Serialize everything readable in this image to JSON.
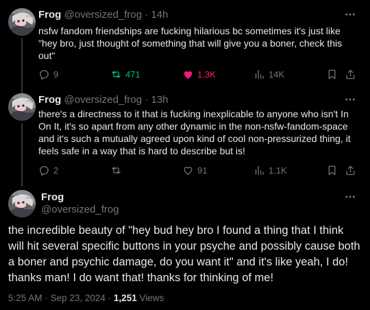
{
  "tweets": [
    {
      "name": "Frog",
      "handle": "@oversized_frog",
      "separator": "·",
      "time": "14h",
      "text": "nsfw fandom friendships are fucking hilarious bc sometimes it's just like \"hey bro, just thought of something that will give you a boner, check this out\"",
      "replies": "9",
      "reposts": "471",
      "likes": "1.3K",
      "views": "14K"
    },
    {
      "name": "Frog",
      "handle": "@oversized_frog",
      "separator": "·",
      "time": "13h",
      "text": "there's a directness to it that is fucking inexplicable to anyone who isn't In On It, it's so apart from any other dynamic in the non-nsfw-fandom-space and it's such a mutually agreed upon kind of cool non-pressurized thing, it feels safe in a way that is hard to describe but is!",
      "replies": "2",
      "reposts": "",
      "likes": "91",
      "views": "1.1K"
    }
  ],
  "main_tweet": {
    "name": "Frog",
    "handle": "@oversized_frog",
    "text": "the incredible beauty of \"hey bud hey bro I found a thing that I think will hit several specific buttons in your psyche and possibly cause both a boner and psychic damage, do you want it\" and it's like yeah, I do! thanks man! I do want that! thanks for thinking of me!",
    "time": "5:25 AM",
    "separator": "·",
    "date": "Sep 23, 2024",
    "views_count": "1,251",
    "views_label": "Views"
  },
  "icons": {
    "more": "more-horizontal-icon",
    "reply": "reply-icon",
    "repost": "repost-icon",
    "like": "heart-icon",
    "views": "views-icon",
    "bookmark": "bookmark-icon",
    "share": "share-icon"
  },
  "colors": {
    "background": "#000000",
    "text": "#e7e9ea",
    "muted": "#71767b",
    "repost_active": "#00ba7c",
    "like_active": "#f91880",
    "thread_line": "#333639"
  }
}
